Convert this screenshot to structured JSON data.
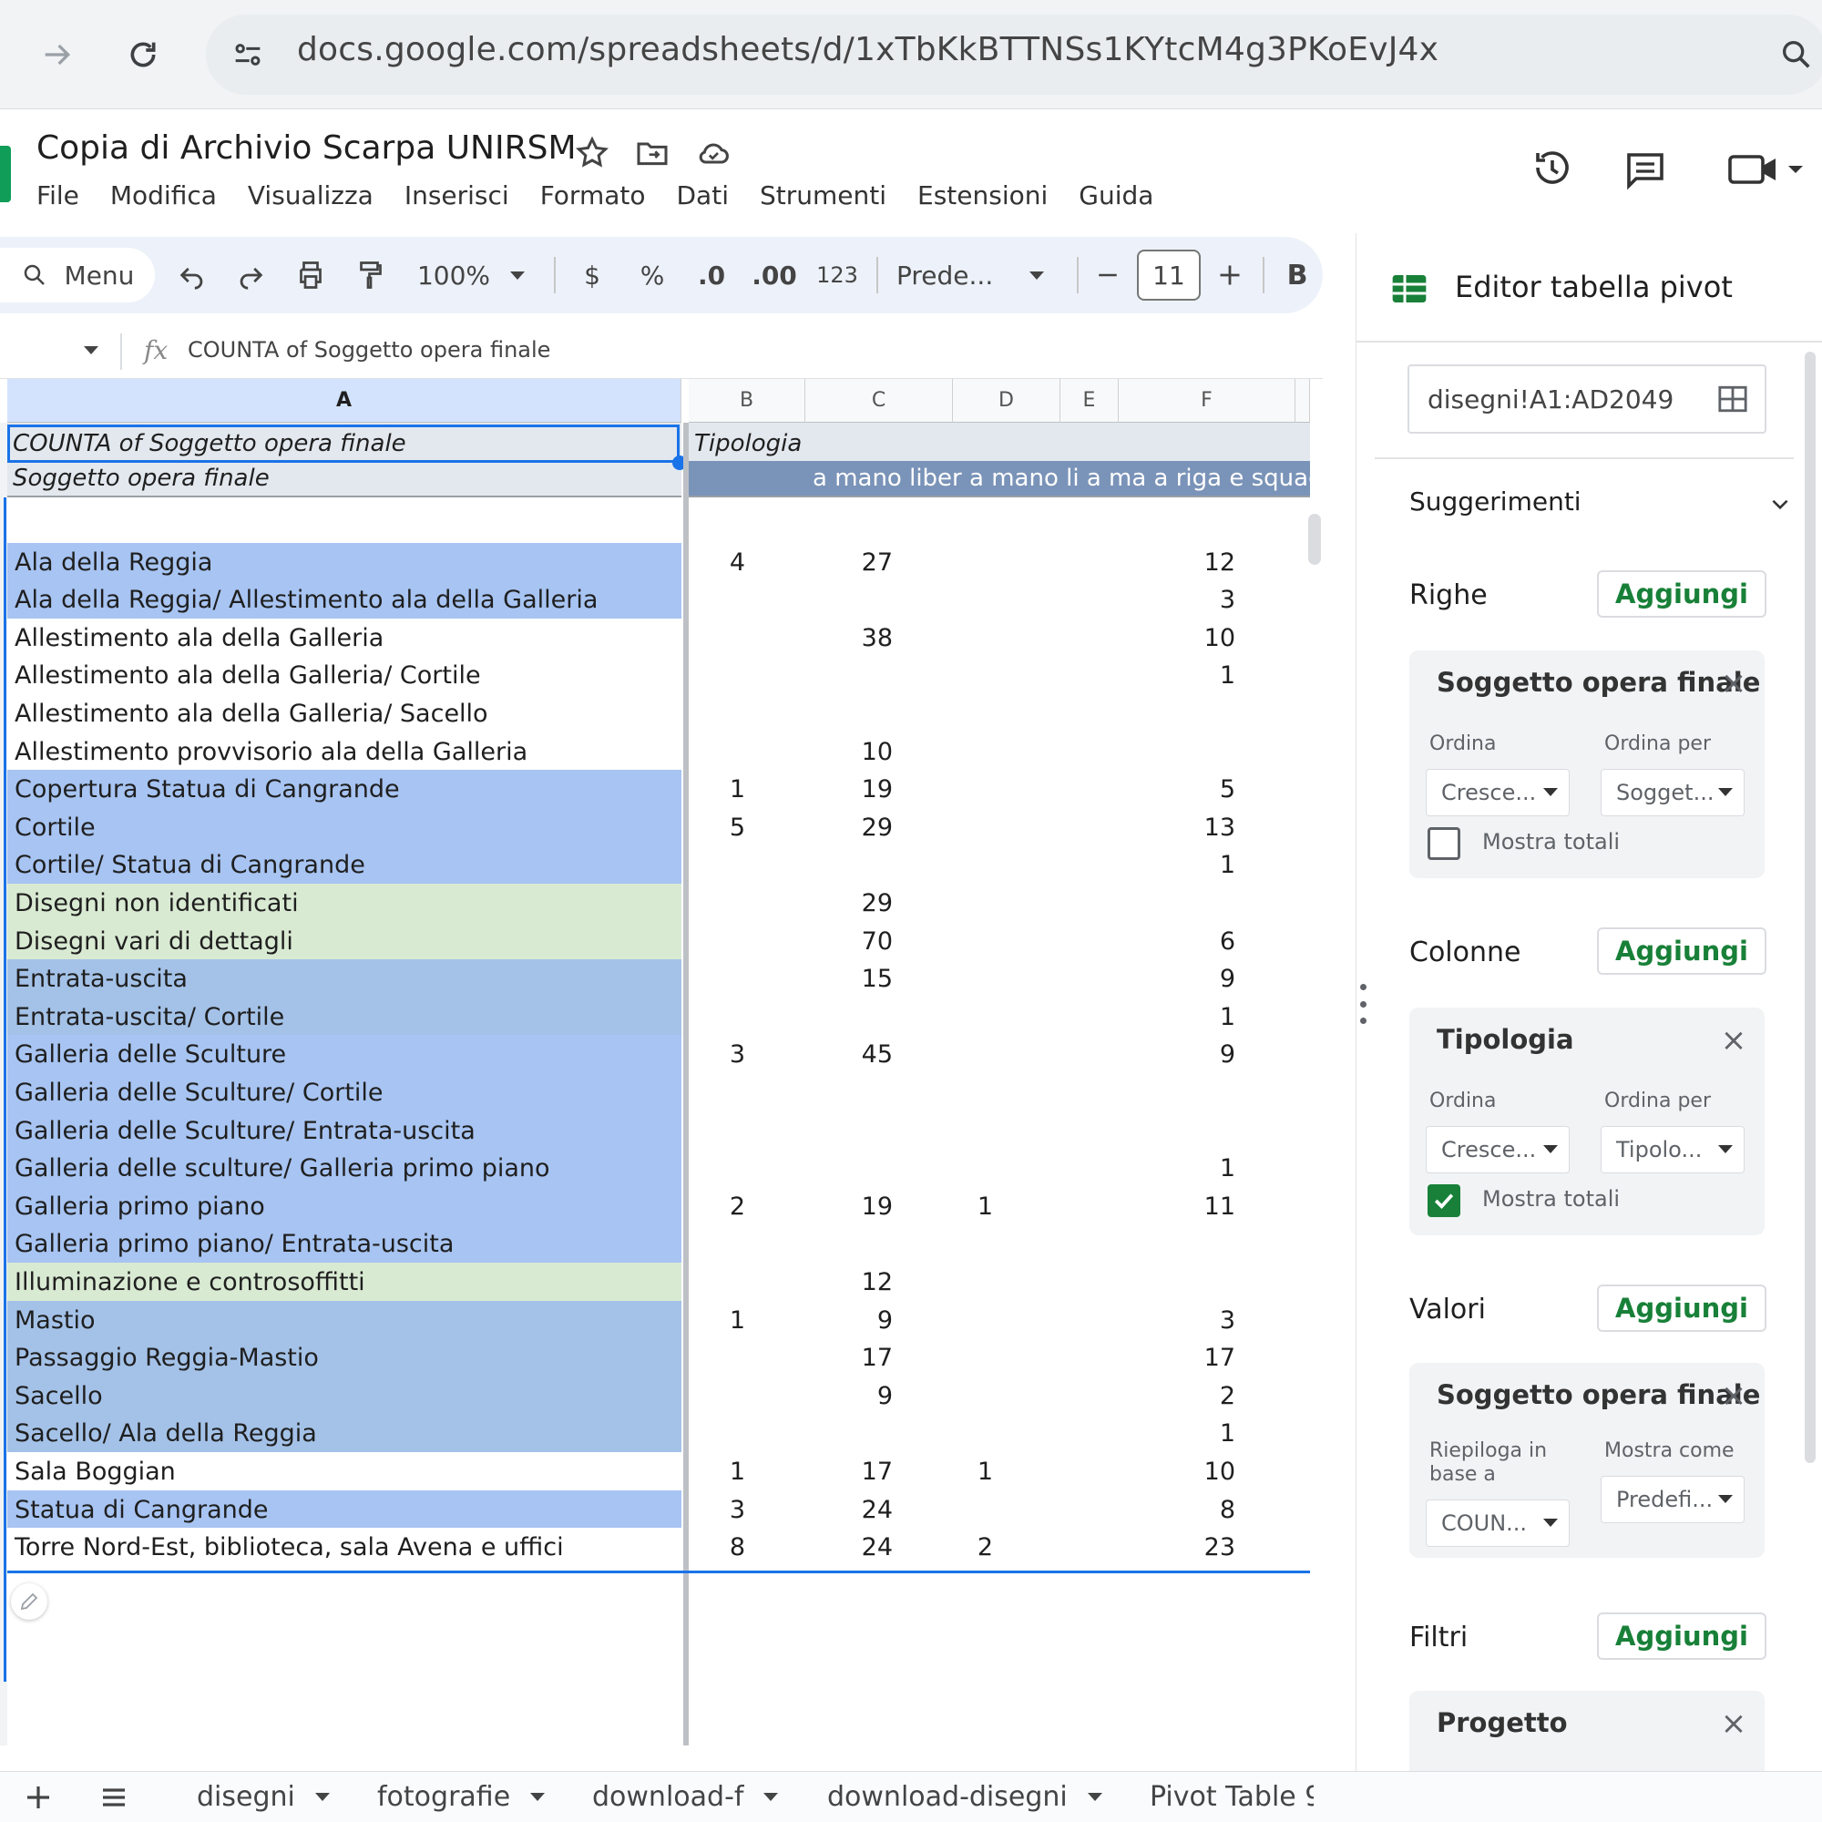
{
  "browser": {
    "url": "docs.google.com/spreadsheets/d/1xTbKkBTTNSs1KYtcM4g3PKoEvJ4x"
  },
  "doc": {
    "title": "Copia di Archivio Scarpa UNIRSM",
    "menus": [
      "File",
      "Modifica",
      "Visualizza",
      "Inserisci",
      "Formato",
      "Dati",
      "Strumenti",
      "Estensioni",
      "Guida"
    ]
  },
  "toolbar": {
    "menu_label": "Menu",
    "zoom": "100%",
    "currency": "$",
    "percent": "%",
    "dec_decrease": ".0",
    "dec_increase": ".00",
    "number_format": "123",
    "font": "Prede...",
    "font_size": "11",
    "bold": "B"
  },
  "formula_bar": {
    "fx": "fx",
    "content": "COUNTA of Soggetto opera finale"
  },
  "grid": {
    "columns": [
      "A",
      "B",
      "C",
      "D",
      "E",
      "F"
    ],
    "pivot_header_row1": {
      "a": "COUNTA of Soggetto opera finale",
      "b": "Tipologia"
    },
    "pivot_header_row2": {
      "a": "Soggetto opera finale",
      "b": "a mano liber a mano li a ma a riga e squadr a"
    },
    "rows": [
      {
        "label": "",
        "b": "",
        "c": "",
        "d": "",
        "f": ""
      },
      {
        "label": "Ala della Reggia",
        "b": "4",
        "c": "27",
        "d": "",
        "f": "12"
      },
      {
        "label": "Ala della Reggia/ Allestimento ala della Galleria",
        "b": "",
        "c": "",
        "d": "",
        "f": "3"
      },
      {
        "label": "Allestimento ala della Galleria",
        "b": "",
        "c": "38",
        "d": "",
        "f": "10"
      },
      {
        "label": "Allestimento ala della Galleria/  Cortile",
        "b": "",
        "c": "",
        "d": "",
        "f": "1"
      },
      {
        "label": "Allestimento ala della Galleria/  Sacello",
        "b": "",
        "c": "",
        "d": "",
        "f": ""
      },
      {
        "label": "Allestimento provvisorio ala della Galleria",
        "b": "",
        "c": "10",
        "d": "",
        "f": ""
      },
      {
        "label": "Copertura Statua di Cangrande",
        "b": "1",
        "c": "19",
        "d": "",
        "f": "5"
      },
      {
        "label": "Cortile",
        "b": "5",
        "c": "29",
        "d": "",
        "f": "13"
      },
      {
        "label": "Cortile/ Statua di Cangrande",
        "b": "",
        "c": "",
        "d": "",
        "f": "1"
      },
      {
        "label": "Disegni non identificati",
        "b": "",
        "c": "29",
        "d": "",
        "f": ""
      },
      {
        "label": "Disegni vari di dettagli",
        "b": "",
        "c": "70",
        "d": "",
        "f": "6"
      },
      {
        "label": "Entrata-uscita",
        "b": "",
        "c": "15",
        "d": "",
        "f": "9"
      },
      {
        "label": "Entrata-uscita/ Cortile",
        "b": "",
        "c": "",
        "d": "",
        "f": "1"
      },
      {
        "label": "Galleria delle Sculture",
        "b": "3",
        "c": "45",
        "d": "",
        "f": "9"
      },
      {
        "label": "Galleria delle Sculture/ Cortile",
        "b": "",
        "c": "",
        "d": "",
        "f": ""
      },
      {
        "label": "Galleria delle Sculture/ Entrata-uscita",
        "b": "",
        "c": "",
        "d": "",
        "f": ""
      },
      {
        "label": "Galleria delle sculture/ Galleria primo piano",
        "b": "",
        "c": "",
        "d": "",
        "f": "1"
      },
      {
        "label": "Galleria primo piano",
        "b": "2",
        "c": "19",
        "d": "1",
        "f": "11"
      },
      {
        "label": "Galleria primo piano/  Entrata-uscita",
        "b": "",
        "c": "",
        "d": "",
        "f": ""
      },
      {
        "label": "Illuminazione e controsoffitti",
        "b": "",
        "c": "12",
        "d": "",
        "f": ""
      },
      {
        "label": "Mastio",
        "b": "1",
        "c": "9",
        "d": "",
        "f": "3"
      },
      {
        "label": "Passaggio Reggia-Mastio",
        "b": "",
        "c": "17",
        "d": "",
        "f": "17"
      },
      {
        "label": "Sacello",
        "b": "",
        "c": "9",
        "d": "",
        "f": "2"
      },
      {
        "label": "Sacello/  Ala della Reggia",
        "b": "",
        "c": "",
        "d": "",
        "f": "1"
      },
      {
        "label": "Sala Boggian",
        "b": "1",
        "c": "17",
        "d": "1",
        "f": "10"
      },
      {
        "label": "Statua di Cangrande",
        "b": "3",
        "c": "24",
        "d": "",
        "f": "8"
      },
      {
        "label": "Torre Nord-Est, biblioteca, sala Avena e uffici",
        "b": "8",
        "c": "24",
        "d": "2",
        "f": "23"
      }
    ],
    "row_colors": [
      "#ffffff",
      "#a7c4f2",
      "#a7c4f2",
      "#ffffff",
      "#ffffff",
      "#ffffff",
      "#ffffff",
      "#a7c4f2",
      "#a7c4f2",
      "#a7c4f2",
      "#d9ead3",
      "#d9ead3",
      "#a4c2e8",
      "#a4c2e8",
      "#a7c4f2",
      "#a7c4f2",
      "#a7c4f2",
      "#a7c4f2",
      "#a7c4f2",
      "#a7c4f2",
      "#d9ead3",
      "#a4c2e8",
      "#a4c2e8",
      "#a4c2e8",
      "#a4c2e8",
      "#ffffff",
      "#a7c4f2",
      "#ffffff"
    ]
  },
  "side_panel": {
    "title": "Editor tabella pivot",
    "range": "disegni!A1:AD2049",
    "suggestions": "Suggerimenti",
    "add_label": "Aggiungi",
    "rows_section": {
      "title": "Righe",
      "field": "Soggetto opera finale",
      "order_label": "Ordina",
      "order_value": "Cresce...",
      "orderby_label": "Ordina per",
      "orderby_value": "Sogget...",
      "totals_label": "Mostra totali",
      "totals_checked": false
    },
    "cols_section": {
      "title": "Colonne",
      "field": "Tipologia",
      "order_label": "Ordina",
      "order_value": "Cresce...",
      "orderby_label": "Ordina per",
      "orderby_value": "Tipolo...",
      "totals_label": "Mostra totali",
      "totals_checked": true
    },
    "values_section": {
      "title": "Valori",
      "field": "Soggetto opera finale",
      "summarize_label": "Riepiloga in base a",
      "summarize_value": "COUN...",
      "show_as_label": "Mostra come",
      "show_as_value": "Predefi..."
    },
    "filters_section": {
      "title": "Filtri",
      "field": "Progetto"
    }
  },
  "sheet_tabs": [
    "disegni",
    "fotografie",
    "download-f",
    "download-disegni",
    "Pivot Table 9"
  ],
  "colors": {
    "accent_green": "#188038",
    "selection_blue": "#1a73e8",
    "header_blue": "#d3e3fd"
  }
}
